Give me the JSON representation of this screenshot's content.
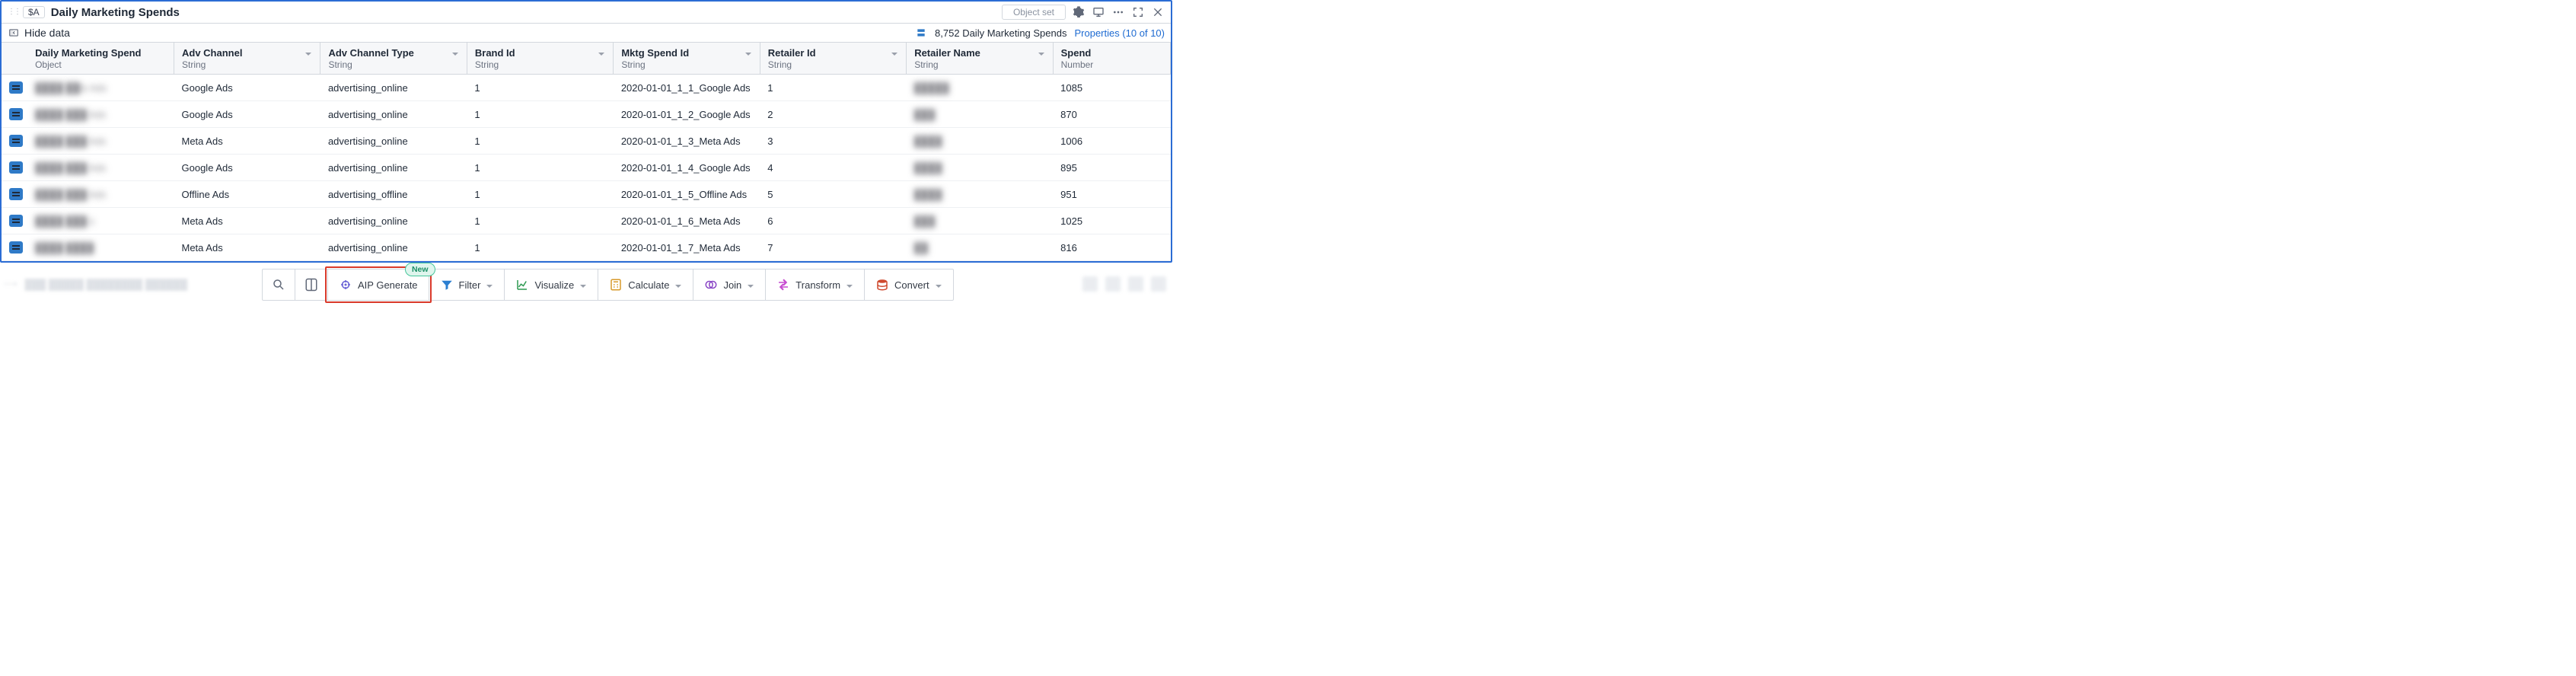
{
  "header": {
    "var_chip": "$A",
    "title": "Daily Marketing Spends",
    "object_set_label": "Object set"
  },
  "sub_bar": {
    "hide_data_label": "Hide data",
    "count_text": "8,752 Daily Marketing Spends",
    "properties_text": "Properties (10 of 10)"
  },
  "columns": [
    {
      "label": "Daily Marketing Spend",
      "sub": "Object",
      "has_caret": false
    },
    {
      "label": "Adv Channel",
      "sub": "String",
      "has_caret": true
    },
    {
      "label": "Adv Channel Type",
      "sub": "String",
      "has_caret": true
    },
    {
      "label": "Brand Id",
      "sub": "String",
      "has_caret": true
    },
    {
      "label": "Mktg Spend Id",
      "sub": "String",
      "has_caret": true
    },
    {
      "label": "Retailer Id",
      "sub": "String",
      "has_caret": true
    },
    {
      "label": "Retailer Name",
      "sub": "String",
      "has_caret": true
    },
    {
      "label": "Spend",
      "sub": "Number",
      "has_caret": false
    }
  ],
  "rows": [
    {
      "spend_name": "████ ██le Ads",
      "adv_channel": "Google Ads",
      "adv_channel_type": "advertising_online",
      "brand_id": "1",
      "mktg_spend_id": "2020-01-01_1_1_Google Ads",
      "retailer_id": "1",
      "retailer_name": "█████",
      "spend": "1085"
    },
    {
      "spend_name": "████ ███ Ads",
      "adv_channel": "Google Ads",
      "adv_channel_type": "advertising_online",
      "brand_id": "1",
      "mktg_spend_id": "2020-01-01_1_2_Google Ads",
      "retailer_id": "2",
      "retailer_name": "███",
      "spend": "870"
    },
    {
      "spend_name": "████ ███ Ads",
      "adv_channel": "Meta Ads",
      "adv_channel_type": "advertising_online",
      "brand_id": "1",
      "mktg_spend_id": "2020-01-01_1_3_Meta Ads",
      "retailer_id": "3",
      "retailer_name": "████",
      "spend": "1006"
    },
    {
      "spend_name": "████ ███ Ads",
      "adv_channel": "Google Ads",
      "adv_channel_type": "advertising_online",
      "brand_id": "1",
      "mktg_spend_id": "2020-01-01_1_4_Google Ads",
      "retailer_id": "4",
      "retailer_name": "████",
      "spend": "895"
    },
    {
      "spend_name": "████ ███ Ads",
      "adv_channel": "Offline Ads",
      "adv_channel_type": "advertising_offline",
      "brand_id": "1",
      "mktg_spend_id": "2020-01-01_1_5_Offline Ads",
      "retailer_id": "5",
      "retailer_name": "████",
      "spend": "951"
    },
    {
      "spend_name": "████ ███ s",
      "adv_channel": "Meta Ads",
      "adv_channel_type": "advertising_online",
      "brand_id": "1",
      "mktg_spend_id": "2020-01-01_1_6_Meta Ads",
      "retailer_id": "6",
      "retailer_name": "███",
      "spend": "1025"
    },
    {
      "spend_name": "████ ████",
      "adv_channel": "Meta Ads",
      "adv_channel_type": "advertising_online",
      "brand_id": "1",
      "mktg_spend_id": "2020-01-01_1_7_Meta Ads",
      "retailer_id": "7",
      "retailer_name": "██",
      "spend": "816"
    }
  ],
  "toolbar": {
    "aip_label": "AIP Generate",
    "aip_badge": "New",
    "filter": "Filter",
    "visualize": "Visualize",
    "calculate": "Calculate",
    "join": "Join",
    "transform": "Transform",
    "convert": "Convert"
  },
  "icon_colors": {
    "aip": "#6a62d6",
    "filter": "#2c7fd1",
    "visualize": "#2e9a52",
    "calculate": "#d79a2b",
    "join": "#8a46c6",
    "transform": "#c64ad0",
    "convert": "#cf4a2f"
  }
}
